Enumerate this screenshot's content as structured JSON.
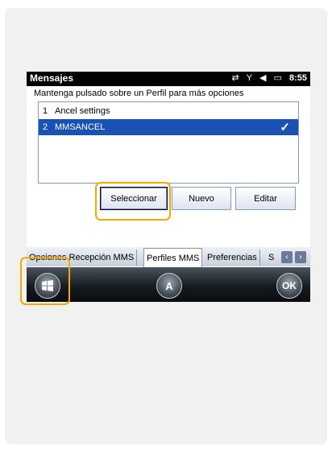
{
  "statusbar": {
    "title": "Mensajes",
    "time": "8:55",
    "icons": [
      "sync-icon",
      "signal-icon",
      "volume-icon",
      "battery-icon"
    ]
  },
  "instruction": "Mantenga pulsado sobre un Perfil para más opciones",
  "profiles": [
    {
      "num": "1",
      "name": "Ancel settings",
      "selected": false
    },
    {
      "num": "2",
      "name": "MMSANCEL",
      "selected": true
    }
  ],
  "buttons": {
    "select": "Seleccionar",
    "new": "Nuevo",
    "edit": "Editar"
  },
  "tabs": [
    "Opciones Recepción MMS",
    "Perfiles MMS",
    "Preferencias",
    "S"
  ],
  "active_tab": "Perfiles MMS",
  "softkeys": {
    "start": "start-icon",
    "input": "A",
    "ok": "OK"
  },
  "colors": {
    "highlight": "#f2a900",
    "selection": "#1a52b3"
  }
}
